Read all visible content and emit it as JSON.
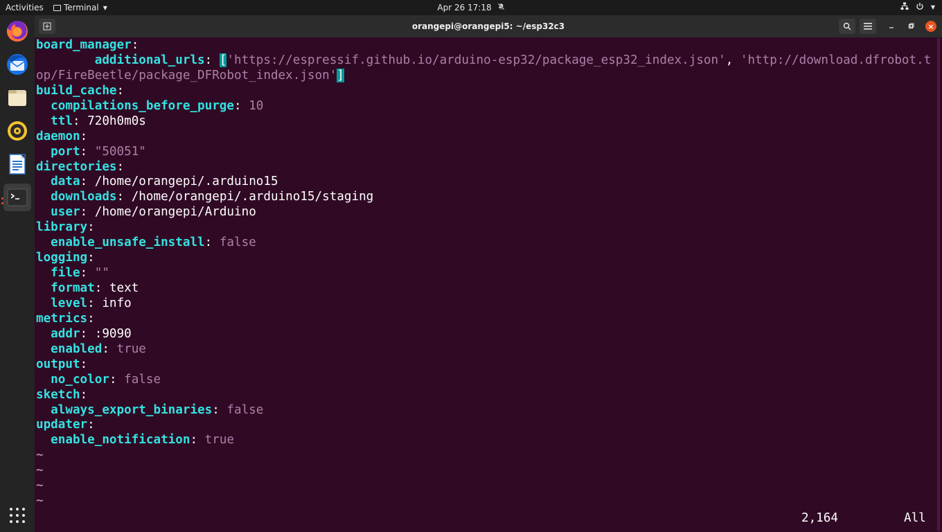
{
  "topbar": {
    "activities": "Activities",
    "app_menu": "Terminal",
    "clock": "Apr 26  17:18"
  },
  "dock": {
    "items": [
      {
        "name": "firefox-icon",
        "color": "#ff7139"
      },
      {
        "name": "thunderbird-icon",
        "color": "#1a73e8"
      },
      {
        "name": "files-icon",
        "color": "#e8d9b0"
      },
      {
        "name": "rhythmbox-icon",
        "color": "#f4c430"
      },
      {
        "name": "libreoffice-writer-icon",
        "color": "#2a72c8"
      },
      {
        "name": "terminal-icon",
        "color": "#2b2b2b"
      }
    ],
    "show_apps": "show-applications-icon"
  },
  "window": {
    "title": "orangepi@orangepi5: ~/esp32c3"
  },
  "editor": {
    "lines": [
      [
        {
          "t": "board_manager",
          "c": "k"
        },
        {
          "t": ":",
          "c": "c"
        }
      ],
      [
        {
          "t": "        additional_urls",
          "c": "k"
        },
        {
          "t": ": ",
          "c": "c"
        },
        {
          "t": "[",
          "c": "hl"
        },
        {
          "t": "'https://espressif.github.io/arduino-esp32/package_esp32_index.json'",
          "c": "s"
        },
        {
          "t": ", ",
          "c": "c"
        },
        {
          "t": "'http://download.dfrobot.t",
          "c": "s"
        }
      ],
      [
        {
          "t": "op/FireBeetle/package_DFRobot_index.json'",
          "c": "s"
        },
        {
          "t": "]",
          "c": "hl"
        }
      ],
      [
        {
          "t": "build_cache",
          "c": "k"
        },
        {
          "t": ":",
          "c": "c"
        }
      ],
      [
        {
          "t": "  compilations_before_purge",
          "c": "k"
        },
        {
          "t": ": ",
          "c": "c"
        },
        {
          "t": "10",
          "c": "n"
        }
      ],
      [
        {
          "t": "  ttl",
          "c": "k"
        },
        {
          "t": ": ",
          "c": "c"
        },
        {
          "t": "720h0m0s",
          "c": "c"
        }
      ],
      [
        {
          "t": "daemon",
          "c": "k"
        },
        {
          "t": ":",
          "c": "c"
        }
      ],
      [
        {
          "t": "  port",
          "c": "k"
        },
        {
          "t": ": ",
          "c": "c"
        },
        {
          "t": "\"50051\"",
          "c": "s"
        }
      ],
      [
        {
          "t": "directories",
          "c": "k"
        },
        {
          "t": ":",
          "c": "c"
        }
      ],
      [
        {
          "t": "  data",
          "c": "k"
        },
        {
          "t": ": ",
          "c": "c"
        },
        {
          "t": "/home/orangepi/.arduino15",
          "c": "c"
        }
      ],
      [
        {
          "t": "  downloads",
          "c": "k"
        },
        {
          "t": ": ",
          "c": "c"
        },
        {
          "t": "/home/orangepi/.arduino15/staging",
          "c": "c"
        }
      ],
      [
        {
          "t": "  user",
          "c": "k"
        },
        {
          "t": ": ",
          "c": "c"
        },
        {
          "t": "/home/orangepi/Arduino",
          "c": "c"
        }
      ],
      [
        {
          "t": "library",
          "c": "k"
        },
        {
          "t": ":",
          "c": "c"
        }
      ],
      [
        {
          "t": "  enable_unsafe_install",
          "c": "k"
        },
        {
          "t": ": ",
          "c": "c"
        },
        {
          "t": "false",
          "c": "n"
        }
      ],
      [
        {
          "t": "logging",
          "c": "k"
        },
        {
          "t": ":",
          "c": "c"
        }
      ],
      [
        {
          "t": "  file",
          "c": "k"
        },
        {
          "t": ": ",
          "c": "c"
        },
        {
          "t": "\"\"",
          "c": "s"
        }
      ],
      [
        {
          "t": "  format",
          "c": "k"
        },
        {
          "t": ": ",
          "c": "c"
        },
        {
          "t": "text",
          "c": "c"
        }
      ],
      [
        {
          "t": "  level",
          "c": "k"
        },
        {
          "t": ": ",
          "c": "c"
        },
        {
          "t": "info",
          "c": "c"
        }
      ],
      [
        {
          "t": "metrics",
          "c": "k"
        },
        {
          "t": ":",
          "c": "c"
        }
      ],
      [
        {
          "t": "  addr",
          "c": "k"
        },
        {
          "t": ": ",
          "c": "c"
        },
        {
          "t": ":9090",
          "c": "c"
        }
      ],
      [
        {
          "t": "  enabled",
          "c": "k"
        },
        {
          "t": ": ",
          "c": "c"
        },
        {
          "t": "true",
          "c": "n"
        }
      ],
      [
        {
          "t": "output",
          "c": "k"
        },
        {
          "t": ":",
          "c": "c"
        }
      ],
      [
        {
          "t": "  no_color",
          "c": "k"
        },
        {
          "t": ": ",
          "c": "c"
        },
        {
          "t": "false",
          "c": "n"
        }
      ],
      [
        {
          "t": "sketch",
          "c": "k"
        },
        {
          "t": ":",
          "c": "c"
        }
      ],
      [
        {
          "t": "  always_export_binaries",
          "c": "k"
        },
        {
          "t": ": ",
          "c": "c"
        },
        {
          "t": "false",
          "c": "n"
        }
      ],
      [
        {
          "t": "updater",
          "c": "k"
        },
        {
          "t": ":",
          "c": "c"
        }
      ],
      [
        {
          "t": "  enable_notification",
          "c": "k"
        },
        {
          "t": ": ",
          "c": "c"
        },
        {
          "t": "true",
          "c": "n"
        }
      ],
      [
        {
          "t": "~",
          "c": "tilde"
        }
      ],
      [
        {
          "t": "~",
          "c": "tilde"
        }
      ],
      [
        {
          "t": "~",
          "c": "tilde"
        }
      ],
      [
        {
          "t": "~",
          "c": "tilde"
        }
      ]
    ],
    "status_position": "2,164",
    "status_scroll": "All"
  },
  "colors": {
    "terminal_bg": "#300a24",
    "key": "#34e2e2",
    "value_literal": "#ad7fa8",
    "cursor_highlight": "#06989a",
    "close_button": "#e95420"
  }
}
